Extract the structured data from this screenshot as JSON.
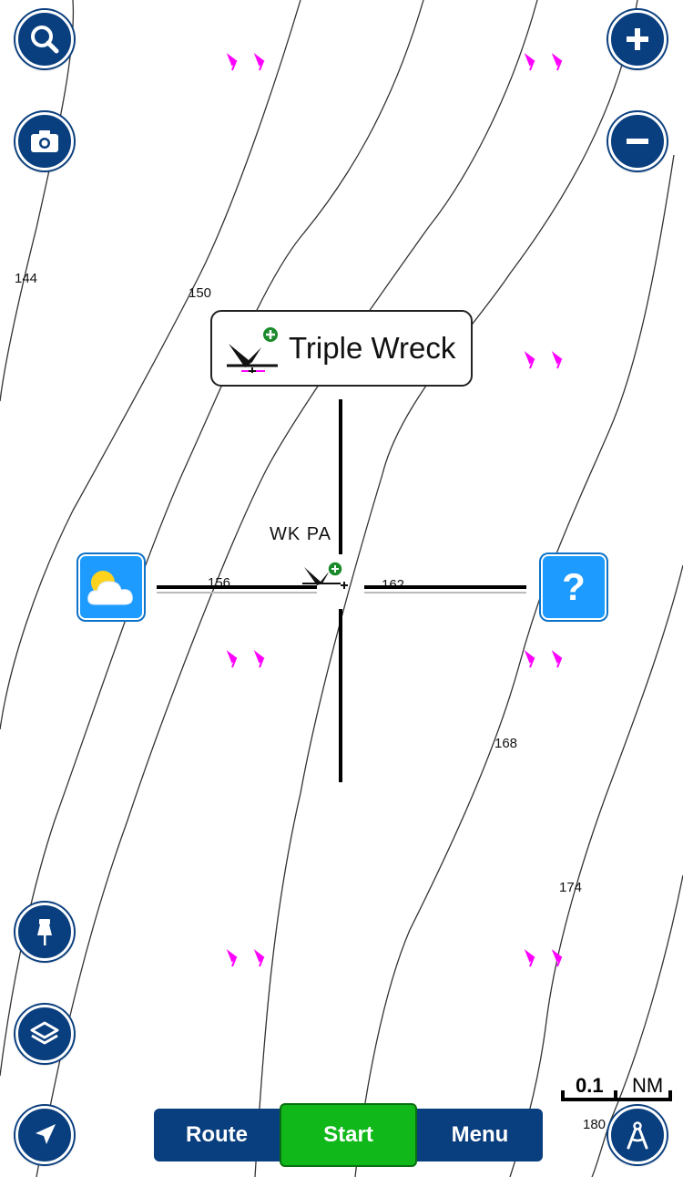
{
  "map": {
    "contour_labels": [
      "144",
      "150",
      "156",
      "162",
      "168",
      "174",
      "180"
    ],
    "marker_label": "WK PA",
    "marker_color": "#ff00ff"
  },
  "callout": {
    "title": "Triple Wreck",
    "icon": "wreck-icon"
  },
  "buttons": {
    "search": "search-icon",
    "camera": "camera-icon",
    "zoom_in": "plus-icon",
    "zoom_out": "minus-icon",
    "pin": "pin-icon",
    "layers": "layers-icon",
    "locate": "navigation-arrow-icon",
    "compass": "compass-tool-icon",
    "weather": "weather-icon",
    "help": "?"
  },
  "bottom_bar": {
    "route": "Route",
    "start": "Start",
    "menu": "Menu"
  },
  "scale": {
    "value": "0.1",
    "unit": "NM"
  },
  "colors": {
    "button_blue": "#0a3f7f",
    "start_green": "#10b81a",
    "info_blue": "#1e9bff"
  }
}
